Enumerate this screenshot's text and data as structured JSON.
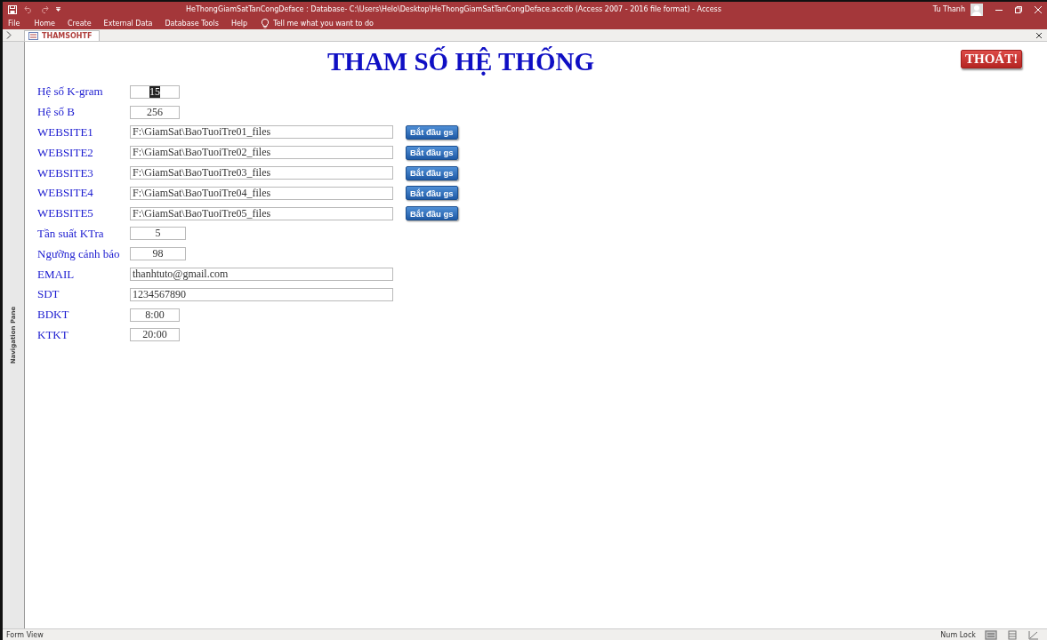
{
  "window": {
    "title": "HeThongGiamSatTanCongDeface : Database- C:\\Users\\Helo\\Desktop\\HeThongGiamSatTanCongDeface.accdb (Access 2007 - 2016 file format)  -  Access",
    "user": "Tu Thanh"
  },
  "menu": [
    {
      "label": "File"
    },
    {
      "label": "Home"
    },
    {
      "label": "Create"
    },
    {
      "label": "External Data"
    },
    {
      "label": "Database Tools"
    },
    {
      "label": "Help"
    }
  ],
  "tell_me": {
    "placeholder": "Tell me what you want to do"
  },
  "document_tab": {
    "label": "THAMSOHTF"
  },
  "navigation_pane": {
    "label": "Navigation Pane"
  },
  "form": {
    "title": "THAM SỐ HỆ THỐNG",
    "exit_button": "THOÁT!",
    "rows": [
      {
        "label": "Hệ số K-gram",
        "value": "15",
        "kind": "short",
        "highlighted": true
      },
      {
        "label": "Hệ số B",
        "value": "256",
        "kind": "short",
        "highlighted": false
      },
      {
        "label": "WEBSITE1",
        "value": "F:\\GiamSat\\BaoTuoiTre01_files",
        "kind": "long",
        "highlighted": false,
        "button": "Bắt đầu gs"
      },
      {
        "label": "WEBSITE2",
        "value": "F:\\GiamSat\\BaoTuoiTre02_files",
        "kind": "long",
        "highlighted": false,
        "button": "Bắt đầu gs"
      },
      {
        "label": "WEBSITE3",
        "value": "F:\\GiamSat\\BaoTuoiTre03_files",
        "kind": "long",
        "highlighted": false,
        "button": "Bắt đầu gs"
      },
      {
        "label": "WEBSITE4",
        "value": "F:\\GiamSat\\BaoTuoiTre04_files",
        "kind": "long",
        "highlighted": false,
        "button": "Bắt đầu gs"
      },
      {
        "label": "WEBSITE5",
        "value": "F:\\GiamSat\\BaoTuoiTre05_files",
        "kind": "long",
        "highlighted": false,
        "button": "Bắt đầu gs"
      },
      {
        "label": "Tần suất KTra",
        "value": "5",
        "kind": "medium",
        "highlighted": false
      },
      {
        "label": "Ngưỡng cảnh báo",
        "value": "98",
        "kind": "medium",
        "highlighted": false
      },
      {
        "label": "EMAIL",
        "value": "thanhtuto@gmail.com",
        "kind": "long",
        "highlighted": false
      },
      {
        "label": "SDT",
        "value": "1234567890",
        "kind": "long",
        "highlighted": false
      },
      {
        "label": "BDKT",
        "value": "8:00",
        "kind": "short",
        "highlighted": false
      },
      {
        "label": "KTKT",
        "value": "20:00",
        "kind": "short",
        "highlighted": false
      }
    ]
  },
  "status_bar": {
    "view": "Form View",
    "num_lock": "Num Lock"
  }
}
